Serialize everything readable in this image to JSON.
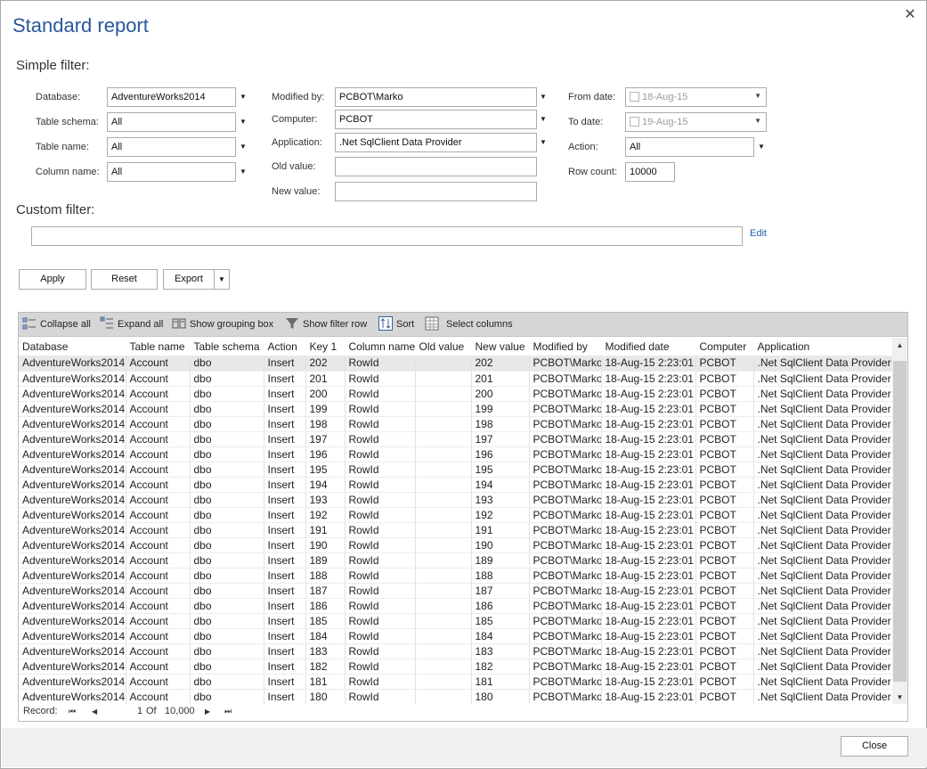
{
  "window": {
    "title": "Standard report",
    "close_glyph": "✕"
  },
  "simple_filter": {
    "heading": "Simple filter:",
    "database": {
      "label": "Database:",
      "value": "AdventureWorks2014"
    },
    "table_schema": {
      "label": "Table schema:",
      "value": "All"
    },
    "table_name": {
      "label": "Table name:",
      "value": "All"
    },
    "column_name": {
      "label": "Column name:",
      "value": "All"
    },
    "modified_by": {
      "label": "Modified by:",
      "value": "PCBOT\\Marko"
    },
    "computer": {
      "label": "Computer:",
      "value": "PCBOT"
    },
    "application": {
      "label": "Application:",
      "value": ".Net SqlClient Data Provider"
    },
    "old_value": {
      "label": "Old value:",
      "value": ""
    },
    "new_value": {
      "label": "New value:",
      "value": ""
    },
    "from_date": {
      "label": "From date:",
      "value": "18-Aug-15"
    },
    "to_date": {
      "label": "To date:",
      "value": "19-Aug-15"
    },
    "action": {
      "label": "Action:",
      "value": "All"
    },
    "row_count": {
      "label": "Row count:",
      "value": "10000"
    }
  },
  "custom_filter": {
    "heading": "Custom filter:",
    "value": "",
    "edit_label": "Edit"
  },
  "buttons": {
    "apply": "Apply",
    "reset": "Reset",
    "export": "Export",
    "close": "Close"
  },
  "toolbar": {
    "collapse_all": "Collapse all",
    "expand_all": "Expand all",
    "show_grouping_box": "Show grouping box",
    "show_filter_row": "Show filter row",
    "sort": "Sort",
    "select_columns": "Select columns"
  },
  "grid": {
    "columns": [
      "Database",
      "Table name",
      "Table schema",
      "Action",
      "Key 1",
      "Column name",
      "Old value",
      "New value",
      "Modified by",
      "Modified date",
      "Computer",
      "Application"
    ],
    "rows": [
      [
        "AdventureWorks2014",
        "Account",
        "dbo",
        "Insert",
        "202",
        "RowId",
        "",
        "202",
        "PCBOT\\Marko",
        "18-Aug-15 2:23:01",
        "PCBOT",
        ".Net SqlClient Data Provider"
      ],
      [
        "AdventureWorks2014",
        "Account",
        "dbo",
        "Insert",
        "201",
        "RowId",
        "",
        "201",
        "PCBOT\\Marko",
        "18-Aug-15 2:23:01",
        "PCBOT",
        ".Net SqlClient Data Provider"
      ],
      [
        "AdventureWorks2014",
        "Account",
        "dbo",
        "Insert",
        "200",
        "RowId",
        "",
        "200",
        "PCBOT\\Marko",
        "18-Aug-15 2:23:01",
        "PCBOT",
        ".Net SqlClient Data Provider"
      ],
      [
        "AdventureWorks2014",
        "Account",
        "dbo",
        "Insert",
        "199",
        "RowId",
        "",
        "199",
        "PCBOT\\Marko",
        "18-Aug-15 2:23:01",
        "PCBOT",
        ".Net SqlClient Data Provider"
      ],
      [
        "AdventureWorks2014",
        "Account",
        "dbo",
        "Insert",
        "198",
        "RowId",
        "",
        "198",
        "PCBOT\\Marko",
        "18-Aug-15 2:23:01",
        "PCBOT",
        ".Net SqlClient Data Provider"
      ],
      [
        "AdventureWorks2014",
        "Account",
        "dbo",
        "Insert",
        "197",
        "RowId",
        "",
        "197",
        "PCBOT\\Marko",
        "18-Aug-15 2:23:01",
        "PCBOT",
        ".Net SqlClient Data Provider"
      ],
      [
        "AdventureWorks2014",
        "Account",
        "dbo",
        "Insert",
        "196",
        "RowId",
        "",
        "196",
        "PCBOT\\Marko",
        "18-Aug-15 2:23:01",
        "PCBOT",
        ".Net SqlClient Data Provider"
      ],
      [
        "AdventureWorks2014",
        "Account",
        "dbo",
        "Insert",
        "195",
        "RowId",
        "",
        "195",
        "PCBOT\\Marko",
        "18-Aug-15 2:23:01",
        "PCBOT",
        ".Net SqlClient Data Provider"
      ],
      [
        "AdventureWorks2014",
        "Account",
        "dbo",
        "Insert",
        "194",
        "RowId",
        "",
        "194",
        "PCBOT\\Marko",
        "18-Aug-15 2:23:01",
        "PCBOT",
        ".Net SqlClient Data Provider"
      ],
      [
        "AdventureWorks2014",
        "Account",
        "dbo",
        "Insert",
        "193",
        "RowId",
        "",
        "193",
        "PCBOT\\Marko",
        "18-Aug-15 2:23:01",
        "PCBOT",
        ".Net SqlClient Data Provider"
      ],
      [
        "AdventureWorks2014",
        "Account",
        "dbo",
        "Insert",
        "192",
        "RowId",
        "",
        "192",
        "PCBOT\\Marko",
        "18-Aug-15 2:23:01",
        "PCBOT",
        ".Net SqlClient Data Provider"
      ],
      [
        "AdventureWorks2014",
        "Account",
        "dbo",
        "Insert",
        "191",
        "RowId",
        "",
        "191",
        "PCBOT\\Marko",
        "18-Aug-15 2:23:01",
        "PCBOT",
        ".Net SqlClient Data Provider"
      ],
      [
        "AdventureWorks2014",
        "Account",
        "dbo",
        "Insert",
        "190",
        "RowId",
        "",
        "190",
        "PCBOT\\Marko",
        "18-Aug-15 2:23:01",
        "PCBOT",
        ".Net SqlClient Data Provider"
      ],
      [
        "AdventureWorks2014",
        "Account",
        "dbo",
        "Insert",
        "189",
        "RowId",
        "",
        "189",
        "PCBOT\\Marko",
        "18-Aug-15 2:23:01",
        "PCBOT",
        ".Net SqlClient Data Provider"
      ],
      [
        "AdventureWorks2014",
        "Account",
        "dbo",
        "Insert",
        "188",
        "RowId",
        "",
        "188",
        "PCBOT\\Marko",
        "18-Aug-15 2:23:01",
        "PCBOT",
        ".Net SqlClient Data Provider"
      ],
      [
        "AdventureWorks2014",
        "Account",
        "dbo",
        "Insert",
        "187",
        "RowId",
        "",
        "187",
        "PCBOT\\Marko",
        "18-Aug-15 2:23:01",
        "PCBOT",
        ".Net SqlClient Data Provider"
      ],
      [
        "AdventureWorks2014",
        "Account",
        "dbo",
        "Insert",
        "186",
        "RowId",
        "",
        "186",
        "PCBOT\\Marko",
        "18-Aug-15 2:23:01",
        "PCBOT",
        ".Net SqlClient Data Provider"
      ],
      [
        "AdventureWorks2014",
        "Account",
        "dbo",
        "Insert",
        "185",
        "RowId",
        "",
        "185",
        "PCBOT\\Marko",
        "18-Aug-15 2:23:01",
        "PCBOT",
        ".Net SqlClient Data Provider"
      ],
      [
        "AdventureWorks2014",
        "Account",
        "dbo",
        "Insert",
        "184",
        "RowId",
        "",
        "184",
        "PCBOT\\Marko",
        "18-Aug-15 2:23:01",
        "PCBOT",
        ".Net SqlClient Data Provider"
      ],
      [
        "AdventureWorks2014",
        "Account",
        "dbo",
        "Insert",
        "183",
        "RowId",
        "",
        "183",
        "PCBOT\\Marko",
        "18-Aug-15 2:23:01",
        "PCBOT",
        ".Net SqlClient Data Provider"
      ],
      [
        "AdventureWorks2014",
        "Account",
        "dbo",
        "Insert",
        "182",
        "RowId",
        "",
        "182",
        "PCBOT\\Marko",
        "18-Aug-15 2:23:01",
        "PCBOT",
        ".Net SqlClient Data Provider"
      ],
      [
        "AdventureWorks2014",
        "Account",
        "dbo",
        "Insert",
        "181",
        "RowId",
        "",
        "181",
        "PCBOT\\Marko",
        "18-Aug-15 2:23:01",
        "PCBOT",
        ".Net SqlClient Data Provider"
      ],
      [
        "AdventureWorks2014",
        "Account",
        "dbo",
        "Insert",
        "180",
        "RowId",
        "",
        "180",
        "PCBOT\\Marko",
        "18-Aug-15 2:23:01",
        "PCBOT",
        ".Net SqlClient Data Provider"
      ]
    ],
    "selected_row": 0
  },
  "navigator": {
    "record_label": "Record:",
    "current": "1",
    "of_label": "Of",
    "total": "10,000",
    "first_glyph": "⏮",
    "prev_glyph": "◀",
    "next_glyph": "▶",
    "last_glyph": "⏭"
  },
  "colors": {
    "accent": "#2b579a",
    "link": "#1f5fa8",
    "toolbar_bg": "#d6d6d6",
    "selected_row": "#e8e8e8"
  }
}
